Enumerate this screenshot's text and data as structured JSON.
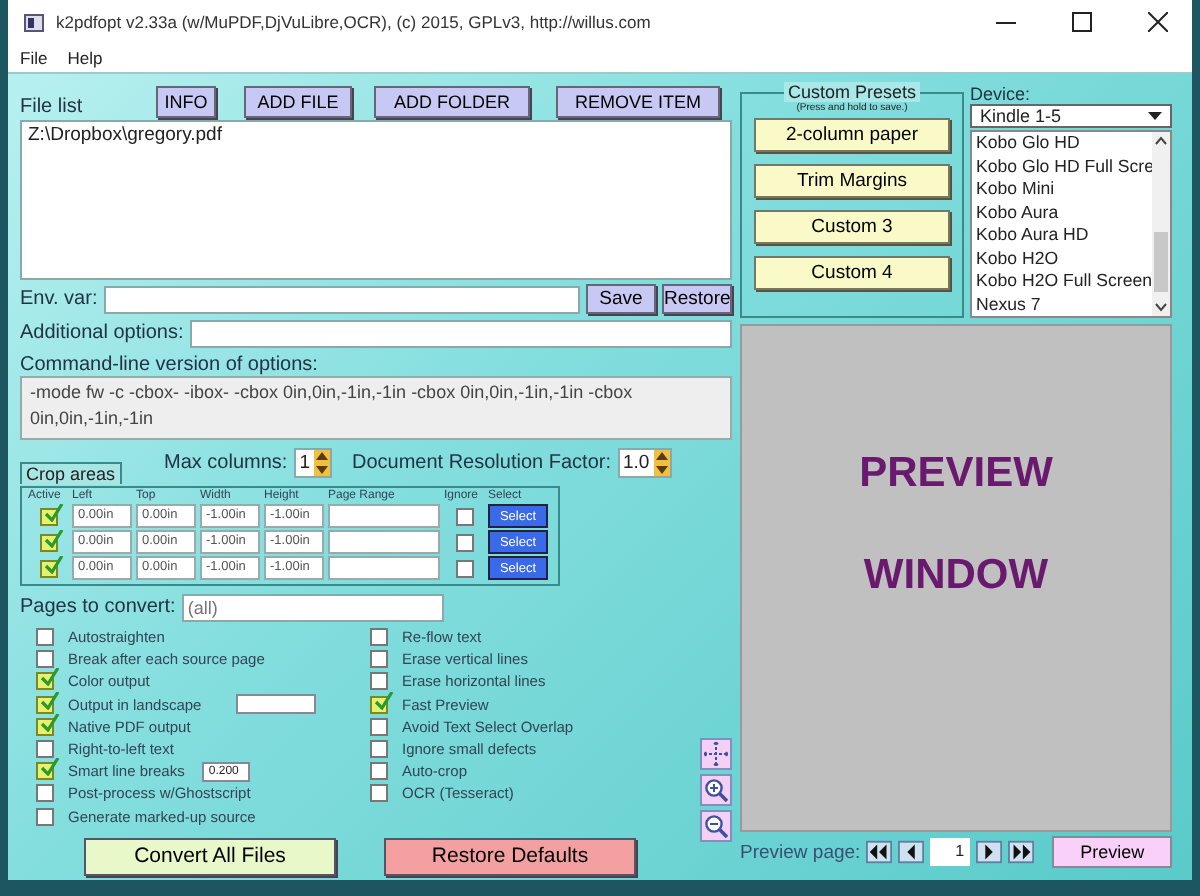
{
  "window": {
    "title": "k2pdfopt v2.33a (w/MuPDF,DjVuLibre,OCR), (c) 2015, GPLv3, http://willus.com"
  },
  "menu": [
    "File",
    "Help"
  ],
  "file_list": {
    "label": "File list",
    "buttons": [
      "INFO",
      "ADD FILE",
      "ADD FOLDER",
      "REMOVE ITEM"
    ],
    "items": [
      "Z:\\Dropbox\\gregory.pdf"
    ]
  },
  "env_var": {
    "label": "Env. var:",
    "buttons": [
      "Save",
      "Restore"
    ]
  },
  "additional_options": {
    "label": "Additional options:"
  },
  "command_line": {
    "label": "Command-line version of options:",
    "text": "-mode fw -c -cbox- -ibox- -cbox 0in,0in,-1in,-1in -cbox 0in,0in,-1in,-1in -cbox 0in,0in,-1in,-1in"
  },
  "max_columns": {
    "label": "Max columns:",
    "value": "1"
  },
  "resolution": {
    "label": "Document Resolution Factor:",
    "value": "1.0"
  },
  "crop_areas": {
    "title": "Crop areas",
    "columns": [
      "Active",
      "Left",
      "Top",
      "Width",
      "Height",
      "Page Range",
      "Ignore",
      "Select"
    ],
    "rows": [
      {
        "active": true,
        "left": "0.00in",
        "top": "0.00in",
        "width": "-1.00in",
        "height": "-1.00in",
        "ignore": false,
        "button": "Select"
      },
      {
        "active": true,
        "left": "0.00in",
        "top": "0.00in",
        "width": "-1.00in",
        "height": "-1.00in",
        "ignore": false,
        "button": "Select"
      },
      {
        "active": true,
        "left": "0.00in",
        "top": "0.00in",
        "width": "-1.00in",
        "height": "-1.00in",
        "ignore": false,
        "button": "Select"
      }
    ]
  },
  "pages_to_convert": {
    "label": "Pages to convert:",
    "placeholder": "(all)"
  },
  "options_left": [
    {
      "kind": "check",
      "label": "Autostraighten",
      "checked": false
    },
    {
      "kind": "check",
      "label": "Break after each source page",
      "checked": false
    },
    {
      "kind": "check",
      "label": "Color output",
      "checked": true
    },
    {
      "kind": "field",
      "label": "Output in landscape",
      "checked": true
    },
    {
      "kind": "check",
      "label": "Native PDF output",
      "checked": true
    },
    {
      "kind": "check",
      "label": "Right-to-left text",
      "checked": false
    },
    {
      "kind": "field",
      "label": "Smart line breaks",
      "checked": true,
      "value": "0.200"
    },
    {
      "kind": "check",
      "label": "Post-process w/Ghostscript",
      "checked": false
    },
    {
      "kind": "check",
      "label": "Generate marked-up source",
      "checked": false
    }
  ],
  "options_right": [
    {
      "label": "Re-flow text",
      "checked": false
    },
    {
      "label": "Erase vertical lines",
      "checked": false
    },
    {
      "label": "Erase horizontal lines",
      "checked": false
    },
    {
      "label": "Fast Preview",
      "checked": true
    },
    {
      "label": "Avoid Text Select Overlap",
      "checked": false
    },
    {
      "label": "Ignore small defects",
      "checked": false
    },
    {
      "label": "Auto-crop",
      "checked": false
    },
    {
      "label": "OCR (Tesseract)",
      "checked": false
    }
  ],
  "actions": [
    {
      "kind": "convert",
      "label": "Convert All Files"
    },
    {
      "kind": "restore",
      "label": "Restore Defaults"
    }
  ],
  "presets": {
    "title": "Custom Presets",
    "subtitle": "(Press and hold to save.)",
    "buttons": [
      "2-column paper",
      "Trim Margins",
      "Custom 3",
      "Custom 4"
    ]
  },
  "device": {
    "label": "Device:",
    "value": "Kindle 1-5",
    "options": [
      "Kobo Glo HD",
      "Kobo Glo HD Full Scre",
      "Kobo Mini",
      "Kobo Aura",
      "Kobo Aura HD",
      "Kobo H2O",
      "Kobo H2O Full Screen",
      "Nexus 7"
    ]
  },
  "preview": {
    "lines": [
      "PREVIEW",
      "WINDOW"
    ]
  },
  "preview_page": {
    "label": "Preview page:",
    "value": "1",
    "button": "Preview"
  }
}
